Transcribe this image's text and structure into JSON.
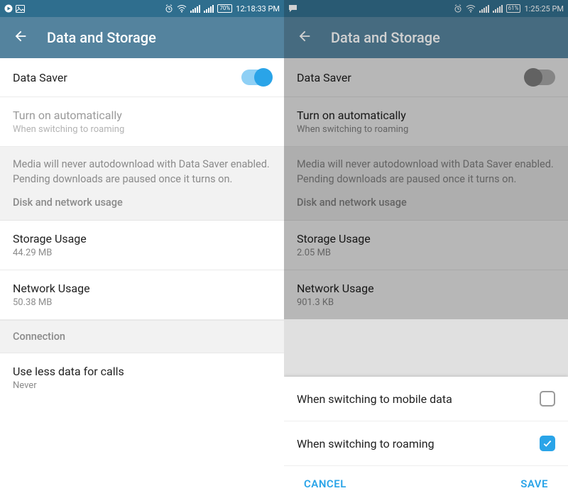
{
  "left": {
    "status": {
      "battery": "70%",
      "time": "12:18:33 PM"
    },
    "appbar": {
      "title": "Data and Storage"
    },
    "dataSaver": {
      "label": "Data Saver",
      "on": true
    },
    "autoOn": {
      "title": "Turn on automatically",
      "sub": "When switching to roaming"
    },
    "info": {
      "text": "Media will never autodownload with Data Saver enabled. Pending downloads are paused once it turns on.",
      "header": "Disk and network usage"
    },
    "storage": {
      "title": "Storage Usage",
      "sub": "44.29 MB"
    },
    "network": {
      "title": "Network Usage",
      "sub": "50.38 MB"
    },
    "connectionHeader": "Connection",
    "lessData": {
      "title": "Use less data for calls",
      "sub": "Never"
    }
  },
  "right": {
    "status": {
      "battery": "61%",
      "time": "1:25:25 PM"
    },
    "appbar": {
      "title": "Data and Storage"
    },
    "dataSaver": {
      "label": "Data Saver",
      "on": false
    },
    "autoOn": {
      "title": "Turn on automatically",
      "sub": "When switching to roaming"
    },
    "info": {
      "text": "Media will never autodownload with Data Saver enabled. Pending downloads are paused once it turns on.",
      "header": "Disk and network usage"
    },
    "storage": {
      "title": "Storage Usage",
      "sub": "2.05 MB"
    },
    "network": {
      "title": "Network Usage",
      "sub": "901.3 KB"
    },
    "sheet": {
      "opt1": {
        "label": "When switching to mobile data",
        "checked": false
      },
      "opt2": {
        "label": "When switching to roaming",
        "checked": true
      },
      "cancel": "CANCEL",
      "save": "SAVE"
    }
  }
}
